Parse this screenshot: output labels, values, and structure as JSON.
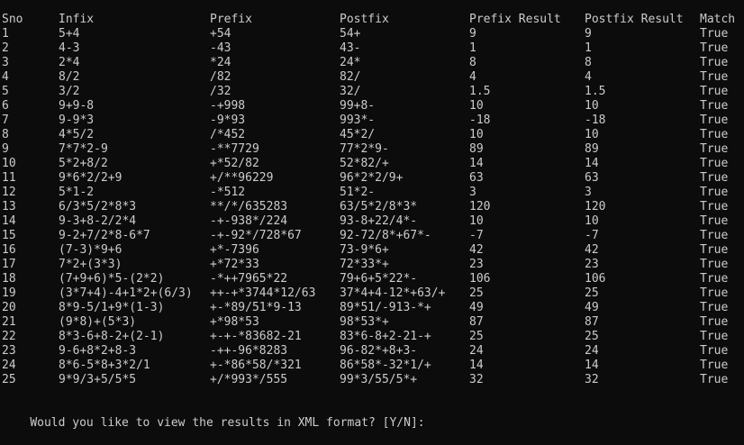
{
  "header": {
    "sno": "Sno",
    "infix": "Infix",
    "prefix": "Prefix",
    "postfix": "Postfix",
    "prefix_result": "Prefix Result",
    "postfix_result": "Postfix Result",
    "match": "Match"
  },
  "rows": [
    [
      "1",
      "5+4",
      "+54",
      "54+",
      "9",
      "9",
      "True"
    ],
    [
      "2",
      "4-3",
      "-43",
      "43-",
      "1",
      "1",
      "True"
    ],
    [
      "3",
      "2*4",
      "*24",
      "24*",
      "8",
      "8",
      "True"
    ],
    [
      "4",
      "8/2",
      "/82",
      "82/",
      "4",
      "4",
      "True"
    ],
    [
      "5",
      "3/2",
      "/32",
      "32/",
      "1.5",
      "1.5",
      "True"
    ],
    [
      "6",
      "9+9-8",
      "-+998",
      "99+8-",
      "10",
      "10",
      "True"
    ],
    [
      "7",
      "9-9*3",
      "-9*93",
      "993*-",
      "-18",
      "-18",
      "True"
    ],
    [
      "8",
      "4*5/2",
      "/*452",
      "45*2/",
      "10",
      "10",
      "True"
    ],
    [
      "9",
      "7*7*2-9",
      "-**7729",
      "77*2*9-",
      "89",
      "89",
      "True"
    ],
    [
      "10",
      "5*2+8/2",
      "+*52/82",
      "52*82/+",
      "14",
      "14",
      "True"
    ],
    [
      "11",
      "9*6*2/2+9",
      "+/**96229",
      "96*2*2/9+",
      "63",
      "63",
      "True"
    ],
    [
      "12",
      "5*1-2",
      "-*512",
      "51*2-",
      "3",
      "3",
      "True"
    ],
    [
      "13",
      "6/3*5/2*8*3",
      "**/*/635283",
      "63/5*2/8*3*",
      "120",
      "120",
      "True"
    ],
    [
      "14",
      "9-3+8-2/2*4",
      "-+-938*/224",
      "93-8+22/4*-",
      "10",
      "10",
      "True"
    ],
    [
      "15",
      "9-2+7/2*8-6*7",
      "-+-92*/728*67",
      "92-72/8*+67*-",
      "-7",
      "-7",
      "True"
    ],
    [
      "16",
      "(7-3)*9+6",
      "+*-7396",
      "73-9*6+",
      "42",
      "42",
      "True"
    ],
    [
      "17",
      "7*2+(3*3)",
      "+*72*33",
      "72*33*+",
      "23",
      "23",
      "True"
    ],
    [
      "18",
      "(7+9+6)*5-(2*2)",
      "-*++7965*22",
      "79+6+5*22*-",
      "106",
      "106",
      "True"
    ],
    [
      "19",
      "(3*7+4)-4+1*2+(6/3)",
      "++-+*3744*12/63",
      "37*4+4-12*+63/+",
      "25",
      "25",
      "True"
    ],
    [
      "20",
      "8*9-5/1+9*(1-3)",
      "+-*89/51*9-13",
      "89*51/-913-*+",
      "49",
      "49",
      "True"
    ],
    [
      "21",
      "(9*8)+(5*3)",
      "+*98*53",
      "98*53*+",
      "87",
      "87",
      "True"
    ],
    [
      "22",
      "8*3-6+8-2+(2-1)",
      "+-+-*83682-21",
      "83*6-8+2-21-+",
      "25",
      "25",
      "True"
    ],
    [
      "23",
      "9-6+8*2+8-3",
      "-++-96*8283",
      "96-82*+8+3-",
      "24",
      "24",
      "True"
    ],
    [
      "24",
      "8*6-5*8+3*2/1",
      "+-*86*58/*321",
      "86*58*-32*1/+",
      "14",
      "14",
      "True"
    ],
    [
      "25",
      "9*9/3+5/5*5",
      "+/*993*/555",
      "99*3/55/5*+",
      "32",
      "32",
      "True"
    ]
  ],
  "prompt": "Would you like to view the results in XML format? [Y/N]:",
  "colors": {
    "background": "#0c0c0c",
    "text": "#cccccc"
  }
}
